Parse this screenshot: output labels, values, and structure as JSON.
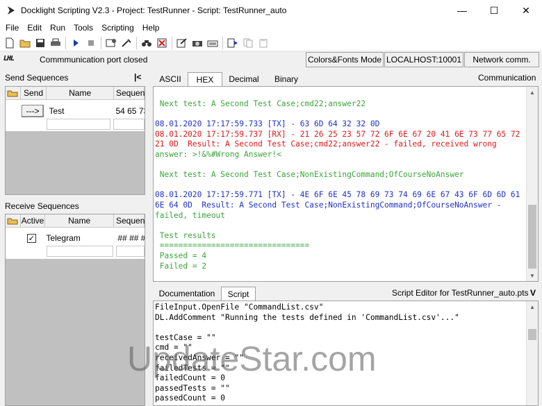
{
  "window": {
    "title": "Docklight Scripting V2.3 - Project: TestRunner - Script: TestRunner_auto",
    "minimize": "—",
    "maximize": "☐",
    "close": "✕"
  },
  "menu": [
    "File",
    "Edit",
    "Run",
    "Tools",
    "Scripting",
    "Help"
  ],
  "toolbar_icons": [
    "new-file-icon",
    "open-folder-icon",
    "save-icon",
    "print-icon",
    "run-icon",
    "stop-icon",
    "project-settings-icon",
    "options-icon",
    "find-icon",
    "clear-icon",
    "edit-sequence-icon",
    "snapshot-icon",
    "keyboard-icon",
    "script-run-icon",
    "copy-icon",
    "paste-icon"
  ],
  "status": {
    "port_logo": "LHL",
    "port_text": "Commmunication port closed",
    "mode": "Colors&Fonts Mode",
    "host": "LOCALHOST:10001",
    "network": "Network comm."
  },
  "send": {
    "label": "Send Sequences",
    "collapse": "|<",
    "headers": [
      "Send",
      "Name",
      "Sequen"
    ],
    "rows": [
      {
        "button": "--->",
        "name": "Test",
        "sequence": "54 65 73"
      }
    ]
  },
  "receive": {
    "label": "Receive Sequences",
    "headers": [
      "Active",
      "Name",
      "Sequen"
    ],
    "rows": [
      {
        "active": "✓",
        "name": "Telegram",
        "sequence": "## ## #"
      }
    ]
  },
  "comm": {
    "tabs": [
      "ASCII",
      "HEX",
      "Decimal",
      "Binary"
    ],
    "active_tab": "HEX",
    "label": "Communication",
    "lines": [
      {
        "text": " Next test: A Second Test Case;cmd22;answer22",
        "color": "green"
      },
      {
        "text": "",
        "color": "green"
      },
      {
        "text": "08.01.2020 17:17:59.733 [TX] - 63 6D 64 32 32 0D",
        "color": "blue"
      },
      {
        "text": "08.01.2020 17:17:59.737 [RX] - 21 26 25 23 57 72 6F 6E 67 20 41 6E 73 77 65 72",
        "color": "red"
      },
      {
        "text": "21 0D  Result: A Second Test Case;cmd22;answer22 - failed, received wrong",
        "color": "red"
      },
      {
        "text": "answer: >!&%#Wrong Answer!<",
        "color": "green"
      },
      {
        "text": "",
        "color": "green"
      },
      {
        "text": " Next test: A Second Test Case;NonExistingCommand;OfCourseNoAnswer",
        "color": "green"
      },
      {
        "text": "",
        "color": "green"
      },
      {
        "text": "08.01.2020 17:17:59.771 [TX] - 4E 6F 6E 45 78 69 73 74 69 6E 67 43 6F 6D 6D 61",
        "color": "blue"
      },
      {
        "text": "6E 64 0D  Result: A Second Test Case;NonExistingCommand;OfCourseNoAnswer -",
        "color": "blue"
      },
      {
        "text": "failed, timeout",
        "color": "green"
      },
      {
        "text": "",
        "color": "green"
      },
      {
        "text": " Test results",
        "color": "green"
      },
      {
        "text": " ================================",
        "color": "green"
      },
      {
        "text": " Passed = 4",
        "color": "green"
      },
      {
        "text": " Failed = 2",
        "color": "green"
      }
    ]
  },
  "script": {
    "tabs": [
      "Documentation",
      "Script"
    ],
    "active_tab": "Script",
    "label": "Script Editor for TestRunner_auto.pts",
    "collapse": "V",
    "lines": [
      "FileInput.OpenFile \"CommandList.csv\"",
      "DL.AddComment \"Running the tests defined in 'CommandList.csv'...\"",
      "",
      "testCase = \"\"",
      "cmd = \"\"",
      "receivedAnswer = \"\"",
      "failedTests = \"\"",
      "failedCount = 0",
      "passedTests = \"\"",
      "passedCount = 0"
    ]
  },
  "watermark": "UpdateStar.com",
  "colors": {
    "green": "#3aa63a",
    "blue": "#1e32c8",
    "red": "#e01818"
  }
}
